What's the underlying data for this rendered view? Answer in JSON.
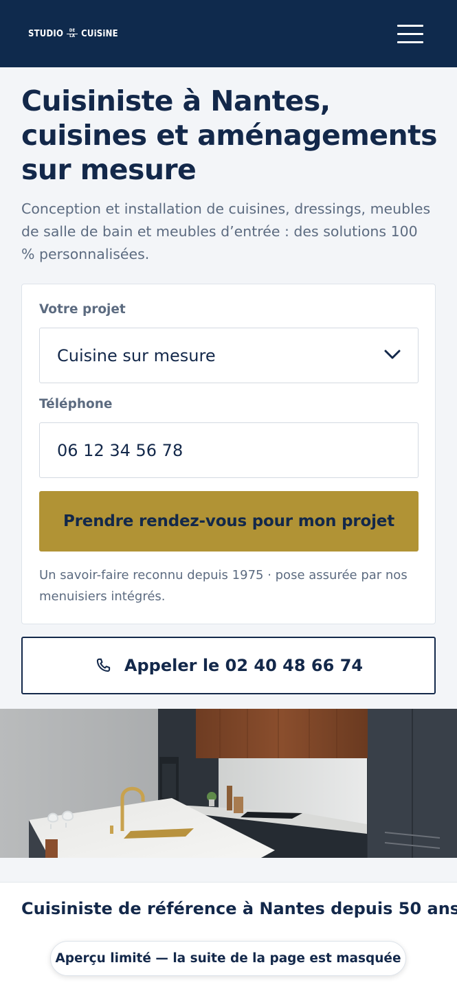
{
  "header": {
    "logo_left": "STUDIO",
    "logo_small_top": "DE",
    "logo_small_bottom": "LA",
    "logo_right": "CUiSiNE",
    "menu_icon": "hamburger-menu-icon"
  },
  "hero": {
    "title": "Cuisiniste à Nantes, cuisines et aménagements sur mesure",
    "subtitle": "Conception et installation de cuisines, dressings, meubles de salle de bain et meubles d’entrée : des solutions 100 % personnalisées."
  },
  "form": {
    "project_label": "Votre projet",
    "project_value": "Cuisine sur mesure",
    "phone_label": "Téléphone",
    "phone_value": "06 12 34 56 78",
    "submit_label": "Prendre rendez-vous pour mon projet",
    "note": "Un savoir-faire reconnu depuis 1975 · pose assurée par nos menuisiers intégrés."
  },
  "call": {
    "label": "Appeler le 02 40 48 66 74",
    "icon": "phone-icon"
  },
  "section": {
    "title": "Cuisiniste de référence à Nantes depuis 50 ans"
  },
  "preview_notice": "Aperçu limité — la suite de la page est masquée",
  "colors": {
    "navy": "#0f2a4d",
    "text": "#13284a",
    "muted": "#5c6b80",
    "gold": "#b19335",
    "background": "#f3f5f8"
  }
}
